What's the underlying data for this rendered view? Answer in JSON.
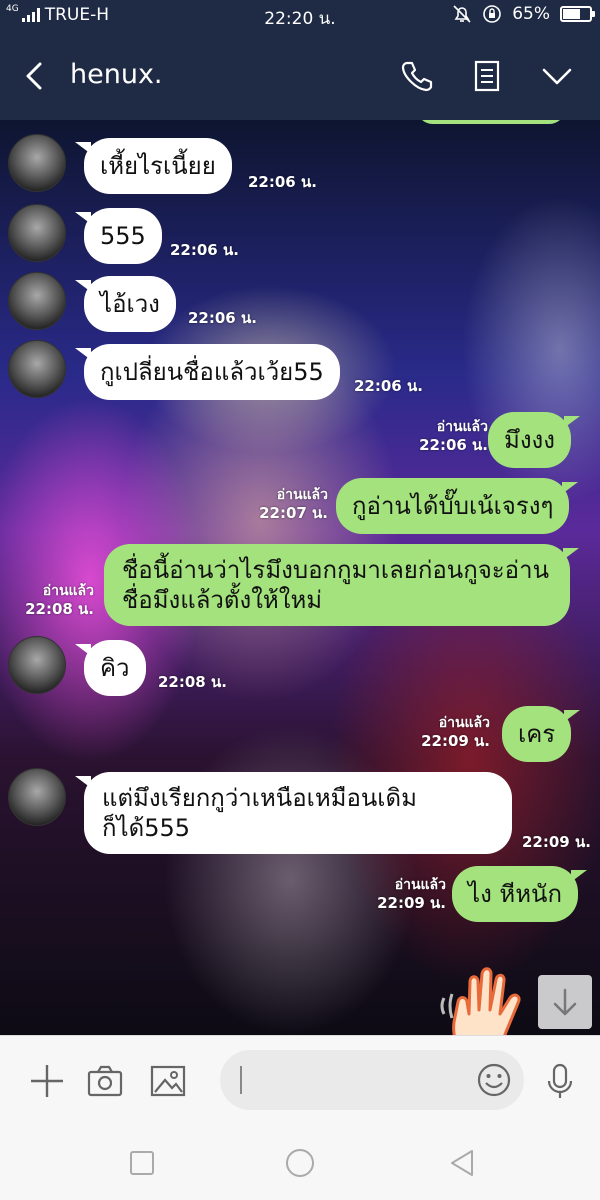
{
  "status_bar": {
    "network": "4G",
    "carrier": "TRUE-H",
    "time": "22:20 น.",
    "battery": "65%",
    "battery_level": 0.65
  },
  "header": {
    "contact_name": "henux.",
    "icons": [
      "back-arrow-icon",
      "phone-icon",
      "notes-icon",
      "chevron-down-icon"
    ]
  },
  "messages": [
    {
      "dir": "in",
      "text": "เหี้ยไรเนี้ยย",
      "time": "22:06 น."
    },
    {
      "dir": "in",
      "text": "555",
      "time": "22:06 น."
    },
    {
      "dir": "in",
      "text": "ไอ้เวง",
      "time": "22:06 น."
    },
    {
      "dir": "in",
      "text": "กูเปลี่ยนชื่อแล้วเว้ย55",
      "time": "22:06 น."
    },
    {
      "dir": "out",
      "text": "มึงงง",
      "read": "อ่านแล้ว",
      "time": "22:06 น."
    },
    {
      "dir": "out",
      "text": "กูอ่านได้บั๊บเน้เจรงๆ",
      "read": "อ่านแล้ว",
      "time": "22:07 น."
    },
    {
      "dir": "out",
      "line1": "ชื่อนี้อ่านว่าไรมึงบอกกูมาเลยก่อนกูจะอ่าน",
      "line2": "ชื่อมึงแล้วตั้งให้ใหม่",
      "read": "อ่านแล้ว",
      "time": "22:08 น."
    },
    {
      "dir": "in",
      "text": "คิว",
      "time": "22:08 น."
    },
    {
      "dir": "out",
      "text": "เคร",
      "read": "อ่านแล้ว",
      "time": "22:09 น."
    },
    {
      "dir": "in",
      "line1": "แต่มึงเรียกกูว่าเหนือเหมือนเดิม",
      "line2": "ก็ได้555",
      "time": "22:09 น."
    },
    {
      "dir": "out",
      "text": "ไง หีหนัก",
      "read": "อ่านแล้ว",
      "time": "22:09 น."
    }
  ],
  "input_bar": {
    "icons": [
      "plus-icon",
      "camera-icon",
      "image-icon",
      "emoji-icon",
      "microphone-icon"
    ],
    "placeholder": ""
  },
  "colors": {
    "header_bg": "#1f2a44",
    "bubble_out": "#a4e27d",
    "bubble_in": "#ffffff",
    "bottom_bg": "#f7f7f7"
  }
}
